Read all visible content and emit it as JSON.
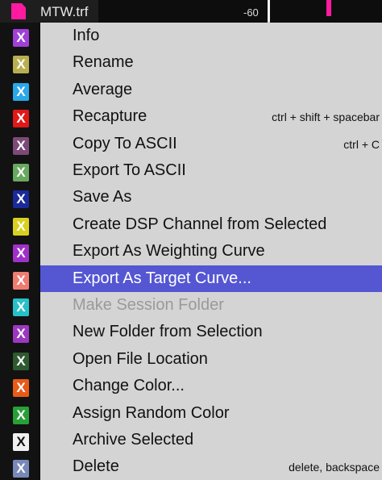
{
  "header": {
    "file_name": "MTW.trf",
    "graph_label": "-60",
    "file_icon_color": "#ff1aa0"
  },
  "channels": [
    {
      "glyph": "X",
      "color": "#a040d8"
    },
    {
      "glyph": "X",
      "color": "#b8b050"
    },
    {
      "glyph": "X",
      "color": "#2aa8e8"
    },
    {
      "glyph": "X",
      "color": "#e01818"
    },
    {
      "glyph": "X",
      "color": "#7c4a78"
    },
    {
      "glyph": "X",
      "color": "#68a860"
    },
    {
      "glyph": "X",
      "color": "#1a2a9a"
    },
    {
      "glyph": "X",
      "color": "#d8d020"
    },
    {
      "glyph": "X",
      "color": "#a030c8"
    },
    {
      "glyph": "X",
      "color": "#ee7c72"
    },
    {
      "glyph": "X",
      "color": "#28c0c8"
    },
    {
      "glyph": "X",
      "color": "#9c38c0"
    },
    {
      "glyph": "X",
      "color": "#2e5a30"
    },
    {
      "glyph": "X",
      "color": "#e85a18"
    },
    {
      "glyph": "X",
      "color": "#28a038"
    },
    {
      "glyph": "X",
      "color": "#f0f0f0"
    },
    {
      "glyph": "X",
      "color": "#7888b8"
    }
  ],
  "menu": {
    "selected_color": "#5456d2",
    "items": [
      {
        "label": "Info",
        "shortcut": ""
      },
      {
        "label": "Rename",
        "shortcut": ""
      },
      {
        "label": "Average",
        "shortcut": ""
      },
      {
        "label": "Recapture",
        "shortcut": "ctrl + shift + spacebar"
      },
      {
        "label": "Copy To ASCII",
        "shortcut": "ctrl + C"
      },
      {
        "label": "Export To ASCII",
        "shortcut": ""
      },
      {
        "label": "Save As",
        "shortcut": ""
      },
      {
        "label": "Create DSP Channel from Selected",
        "shortcut": ""
      },
      {
        "label": "Export As Weighting Curve",
        "shortcut": ""
      },
      {
        "label": "Export As Target Curve...",
        "shortcut": "",
        "state": "selected"
      },
      {
        "label": "Make Session Folder",
        "shortcut": "",
        "state": "disabled"
      },
      {
        "label": "New Folder from Selection",
        "shortcut": ""
      },
      {
        "label": "Open File Location",
        "shortcut": ""
      },
      {
        "label": "Change Color...",
        "shortcut": ""
      },
      {
        "label": "Assign Random Color",
        "shortcut": ""
      },
      {
        "label": "Archive Selected",
        "shortcut": ""
      },
      {
        "label": "Delete",
        "shortcut": "delete, backspace"
      }
    ]
  }
}
